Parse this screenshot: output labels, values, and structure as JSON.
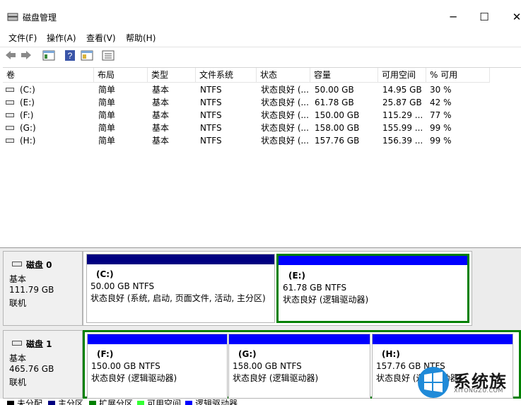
{
  "window": {
    "title": "磁盘管理",
    "controls": {
      "minimize": "─",
      "maximize": "☐",
      "close": "✕"
    }
  },
  "menu": [
    "文件(F)",
    "操作(A)",
    "查看(V)",
    "帮助(H)"
  ],
  "toolbar": [
    "back-icon",
    "forward-icon",
    "console-tree-icon",
    "help-icon",
    "properties-icon",
    "list-view-icon"
  ],
  "volume_table": {
    "columns": [
      "卷",
      "布局",
      "类型",
      "文件系统",
      "状态",
      "容量",
      "可用空间",
      "% 可用"
    ],
    "rows": [
      [
        "(C:)",
        "简单",
        "基本",
        "NTFS",
        "状态良好 (...",
        "50.00 GB",
        "14.95 GB",
        "30 %"
      ],
      [
        "(E:)",
        "简单",
        "基本",
        "NTFS",
        "状态良好 (...",
        "61.78 GB",
        "25.87 GB",
        "42 %"
      ],
      [
        "(F:)",
        "简单",
        "基本",
        "NTFS",
        "状态良好 (...",
        "150.00 GB",
        "115.29 ...",
        "77 %"
      ],
      [
        "(G:)",
        "简单",
        "基本",
        "NTFS",
        "状态良好 (...",
        "158.00 GB",
        "155.99 ...",
        "99 %"
      ],
      [
        "(H:)",
        "简单",
        "基本",
        "NTFS",
        "状态良好 (...",
        "157.76 GB",
        "156.39 ...",
        "99 %"
      ]
    ]
  },
  "disks": [
    {
      "name": "磁盘 0",
      "type": "基本",
      "size": "111.79 GB",
      "status": "联机",
      "partitions": [
        {
          "letter": "(C:)",
          "size": "50.00 GB NTFS",
          "status": "状态良好 (系统, 启动, 页面文件, 活动, 主分区)",
          "kind": "primary"
        },
        {
          "letter": "(E:)",
          "size": "61.78 GB NTFS",
          "status": "状态良好 (逻辑驱动器)",
          "kind": "logical"
        }
      ]
    },
    {
      "name": "磁盘 1",
      "type": "基本",
      "size": "465.76 GB",
      "status": "联机",
      "partitions": [
        {
          "letter": "(F:)",
          "size": "150.00 GB NTFS",
          "status": "状态良好 (逻辑驱动器)",
          "kind": "logical"
        },
        {
          "letter": "(G:)",
          "size": "158.00 GB NTFS",
          "status": "状态良好 (逻辑驱动器)",
          "kind": "logical"
        },
        {
          "letter": "(H:)",
          "size": "157.76 GB NTFS",
          "status": "状态良好 (逻辑驱动器)",
          "kind": "logical"
        }
      ]
    }
  ],
  "legend": [
    {
      "label": "未分配",
      "color": "#000000"
    },
    {
      "label": "主分区",
      "color": "#000080"
    },
    {
      "label": "扩展分区",
      "color": "#008000"
    },
    {
      "label": "可用空间",
      "color": "#33ff33"
    },
    {
      "label": "逻辑驱动器",
      "color": "#0000ff"
    }
  ],
  "colors": {
    "primary": "#000080",
    "logical": "#0000ff",
    "extended": "#008000"
  },
  "watermark": {
    "text": "系统族",
    "url": "XITONGZU.COM"
  }
}
